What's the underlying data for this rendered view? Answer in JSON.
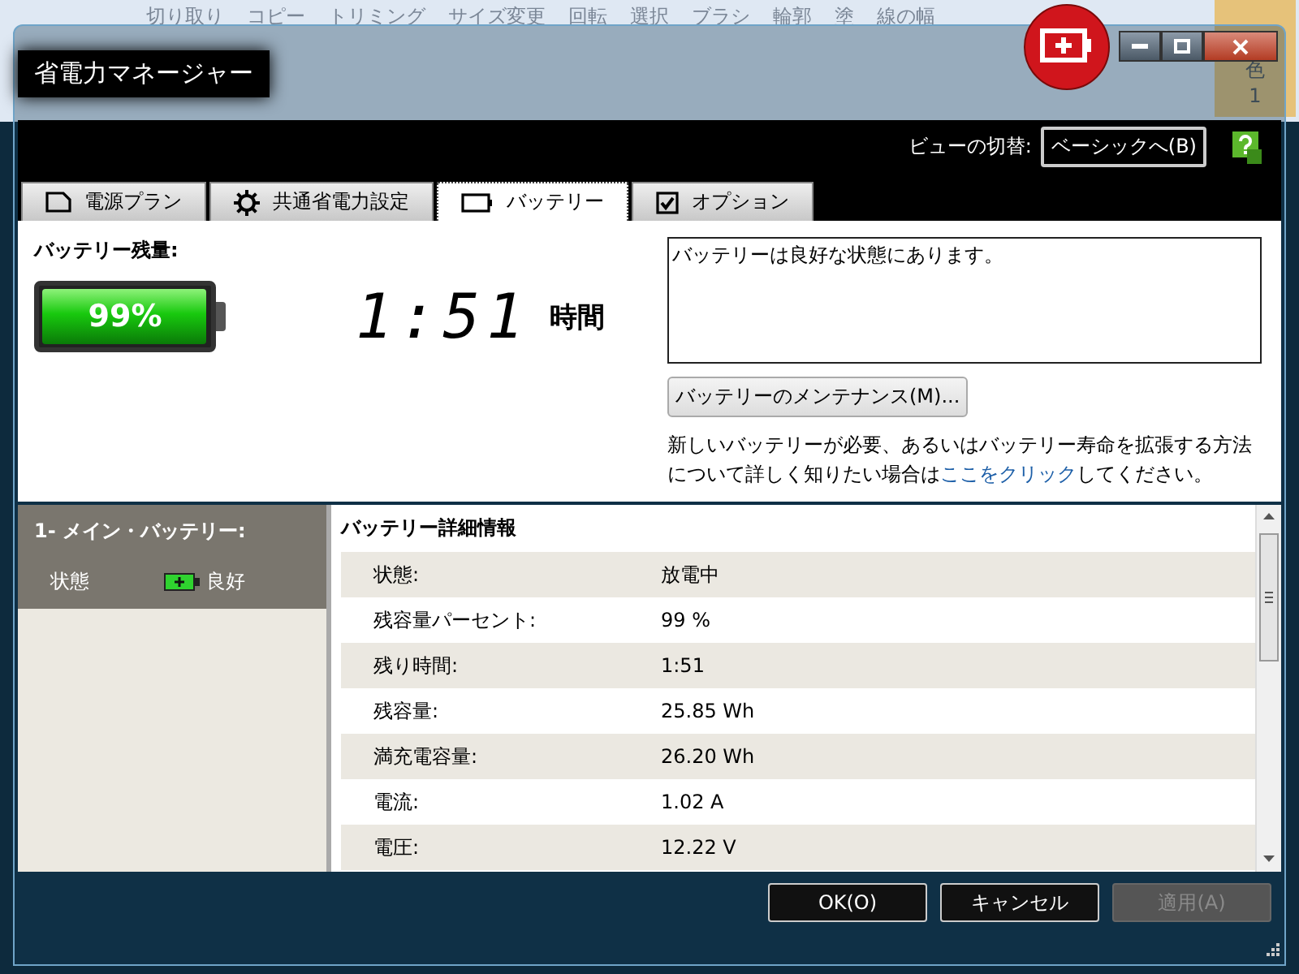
{
  "background_ribbon": {
    "items": [
      "切り取り",
      "コピー",
      "トリミング",
      "サイズ変更",
      "回転",
      "選択",
      "ブラシ",
      "輪郭",
      "塗",
      "線の幅"
    ],
    "color_label": "色",
    "color_number": "1"
  },
  "window": {
    "title": "省電力マネージャー"
  },
  "view_switch": {
    "label": "ビューの切替:",
    "button": "ベーシックへ(B)"
  },
  "tabs": [
    {
      "label": "電源プラン",
      "kind": "plan",
      "selected": false
    },
    {
      "label": "共通省電力設定",
      "kind": "gear",
      "selected": false
    },
    {
      "label": "バッテリー",
      "kind": "battery",
      "selected": true
    },
    {
      "label": "オプション",
      "kind": "check",
      "selected": false
    }
  ],
  "battery": {
    "heading": "バッテリー残量:",
    "percent": "99%",
    "level": 0.99,
    "time": "1:51",
    "time_unit": "時間"
  },
  "status_box": {
    "value": "バッテリーは良好な状態にあります。"
  },
  "maintenance_button": "バッテリーのメンテナンス(M)...",
  "info": {
    "before": "新しいバッテリーが必要、あるいはバッテリー寿命を拡張する方法について詳しく知りたい場合は",
    "link": "ここをクリック",
    "after": "してください。"
  },
  "battery_list": {
    "title": "1- メイン・バッテリー:",
    "state_label": "状態",
    "state_value": "良好"
  },
  "details": {
    "title": "バッテリー詳細情報",
    "rows": [
      {
        "label": "状態:",
        "value": "放電中"
      },
      {
        "label": "残容量パーセント:",
        "value": "99 %"
      },
      {
        "label": "残り時間:",
        "value": "1:51"
      },
      {
        "label": "残容量:",
        "value": "25.85 Wh"
      },
      {
        "label": "満充電容量:",
        "value": "26.20 Wh"
      },
      {
        "label": "電流:",
        "value": "1.02 A"
      },
      {
        "label": "電圧:",
        "value": "12.22 V"
      }
    ]
  },
  "buttons": [
    {
      "label": "OK(O)",
      "disabled": false
    },
    {
      "label": "キャンセル",
      "disabled": false
    },
    {
      "label": "適用(A)",
      "disabled": true
    }
  ]
}
